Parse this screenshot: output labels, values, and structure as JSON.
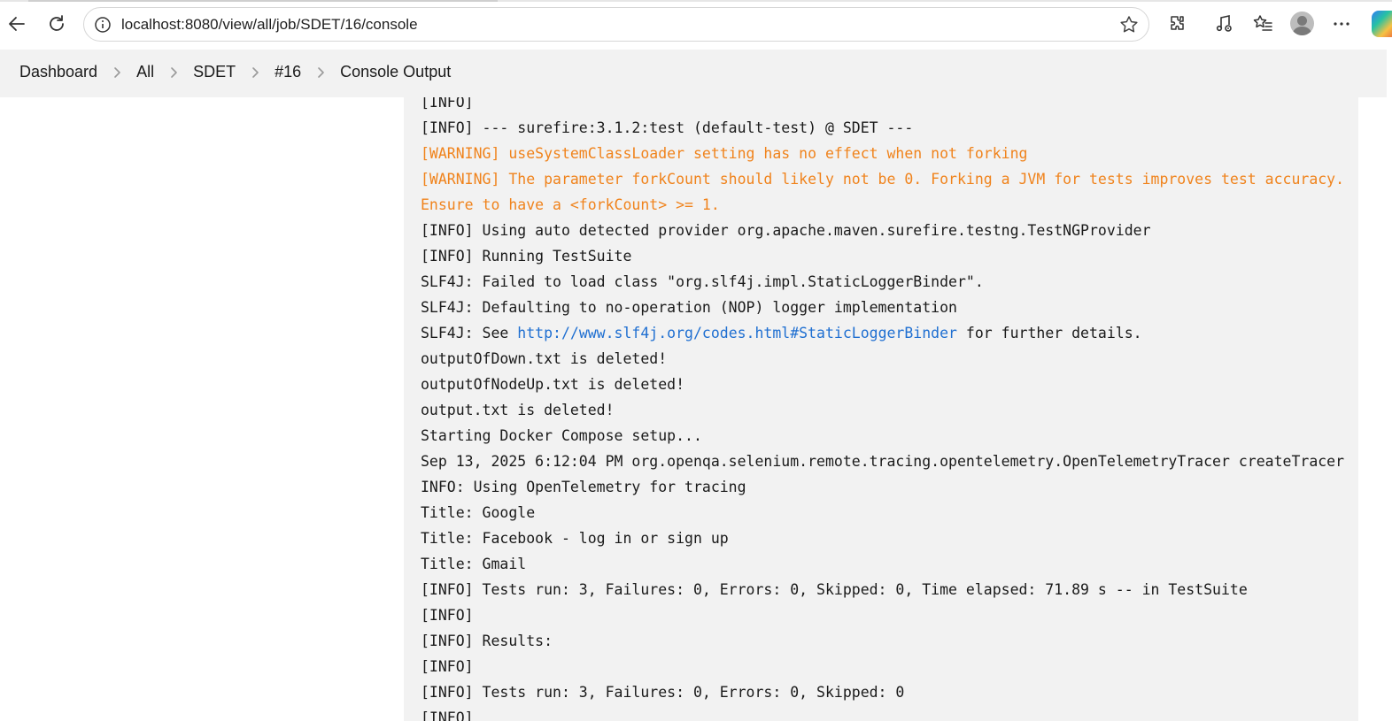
{
  "browser": {
    "url": "localhost:8080/view/all/job/SDET/16/console"
  },
  "breadcrumbs": [
    {
      "label": "Dashboard"
    },
    {
      "label": "All"
    },
    {
      "label": "SDET"
    },
    {
      "label": "#16"
    },
    {
      "label": "Console Output"
    }
  ],
  "console": {
    "lines": {
      "l0": {
        "text": "[INFO]"
      },
      "l1": {
        "text": "[INFO] --- surefire:3.1.2:test (default-test) @ SDET ---"
      },
      "l2": {
        "text": "[WARNING] useSystemClassLoader setting has no effect when not forking"
      },
      "l3": {
        "text": "[WARNING] The parameter forkCount should likely not be 0. Forking a JVM for tests improves test accuracy."
      },
      "l4": {
        "text": "Ensure to have a <forkCount> >= 1."
      },
      "l5": {
        "text": "[INFO] Using auto detected provider org.apache.maven.surefire.testng.TestNGProvider"
      },
      "l6": {
        "text": "[INFO] Running TestSuite"
      },
      "l7": {
        "text": "SLF4J: Failed to load class \"org.slf4j.impl.StaticLoggerBinder\"."
      },
      "l8": {
        "text": "SLF4J: Defaulting to no-operation (NOP) logger implementation"
      },
      "l9": {
        "prefix": "SLF4J: See ",
        "link": "http://www.slf4j.org/codes.html#StaticLoggerBinder",
        "suffix": " for further details."
      },
      "l10": {
        "text": "outputOfDown.txt is deleted!"
      },
      "l11": {
        "text": "outputOfNodeUp.txt is deleted!"
      },
      "l12": {
        "text": "output.txt is deleted!"
      },
      "l13": {
        "text": "Starting Docker Compose setup..."
      },
      "l14": {
        "text": "Sep 13, 2025 6:12:04 PM org.openqa.selenium.remote.tracing.opentelemetry.OpenTelemetryTracer createTracer"
      },
      "l15": {
        "text": "INFO: Using OpenTelemetry for tracing"
      },
      "l16": {
        "text": "Title: Google"
      },
      "l17": {
        "text": "Title: Facebook - log in or sign up"
      },
      "l18": {
        "text": "Title: Gmail"
      },
      "l19": {
        "text": "[INFO] Tests run: 3, Failures: 0, Errors: 0, Skipped: 0, Time elapsed: 71.89 s -- in TestSuite"
      },
      "l20": {
        "text": "[INFO]"
      },
      "l21": {
        "text": "[INFO] Results:"
      },
      "l22": {
        "text": "[INFO]"
      },
      "l23": {
        "text": "[INFO] Tests run: 3, Failures: 0, Errors: 0, Skipped: 0"
      },
      "l24": {
        "text": "[INFO]"
      }
    }
  },
  "colors": {
    "warning": "#f0831c",
    "link": "#1f6fd1",
    "console_bg": "#f2f2f2"
  }
}
